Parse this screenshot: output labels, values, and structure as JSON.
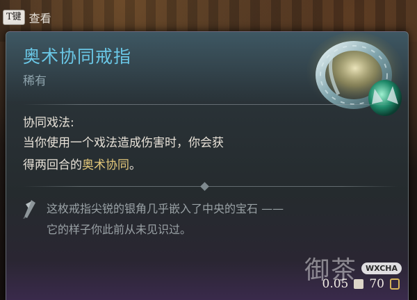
{
  "hint": {
    "key": "T键",
    "label": "查看"
  },
  "item": {
    "name": "奥术协同戒指",
    "rarity": "稀有",
    "icon": "ring-icon"
  },
  "effect": {
    "title": "协同戏法:",
    "line1": "当你使用一个戏法造成伤害时，你会获",
    "line2_prefix": "得两回合的",
    "line2_keyword": "奥术协同",
    "line2_suffix": "。"
  },
  "flavor": {
    "icon": "quill-icon",
    "line1": "这枚戒指尖锐的银角几乎嵌入了中央的宝石 ——",
    "line2": "它的样子你此前从未见识过。"
  },
  "footer": {
    "weight": "0.05",
    "price": "70"
  },
  "watermark": {
    "text": "御茶",
    "badge": "WXCHA"
  },
  "colors": {
    "name": "#6ac7e6",
    "keyword": "#e4c87a",
    "body": "#e8e2d8",
    "flavor": "#9aa2a6"
  }
}
